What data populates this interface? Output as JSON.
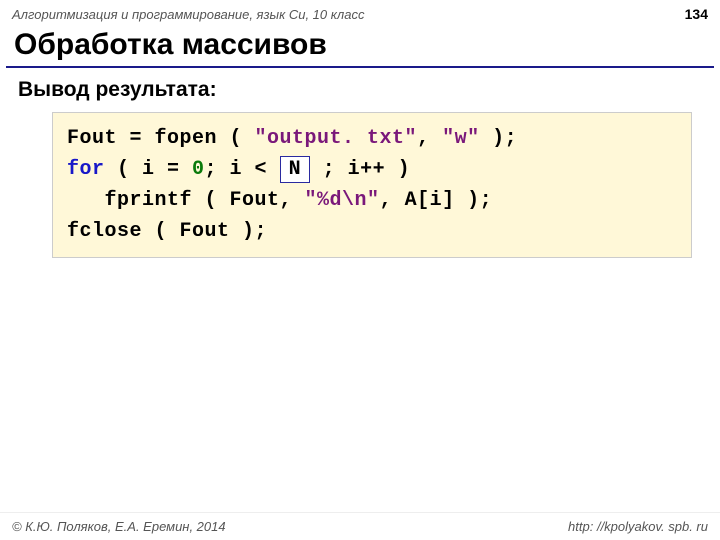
{
  "header": {
    "course": "Алгоритмизация и программирование, язык Си, 10 класс",
    "page": "134"
  },
  "title": "Обработка массивов",
  "subtitle": "Вывод результата:",
  "code": {
    "line1": {
      "a": "Fout = fopen ( ",
      "s": "\"output. txt\"",
      "b": ", ",
      "s2": "\"w\"",
      "c": " );"
    },
    "line2": {
      "kw": "for",
      "a": " ( i = ",
      "zero": "0",
      "b": "; i < ",
      "box": "N",
      "c": " ; i++ )"
    },
    "line3": {
      "a": "   fprintf ( Fout, ",
      "s": "\"%d\\n\"",
      "b": ", A[i] );"
    },
    "line4": "fclose ( Fout );"
  },
  "footer": {
    "copyright": "© К.Ю. Поляков, Е.А. Еремин, 2014",
    "url": "http: //kpolyakov. spb. ru"
  }
}
